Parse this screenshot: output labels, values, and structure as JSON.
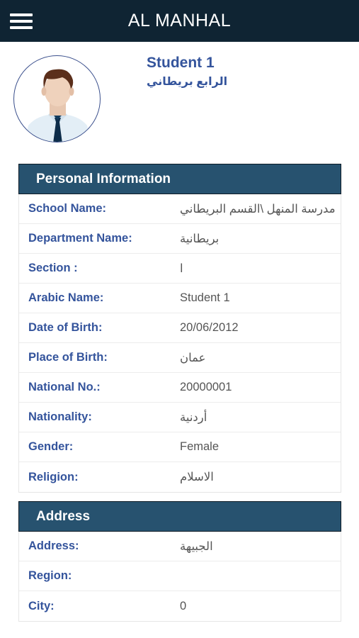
{
  "header": {
    "title": "AL MANHAL",
    "menu_icon": "hamburger-menu-icon"
  },
  "profile": {
    "name": "Student 1",
    "grade": "الرابع بريطاني",
    "avatar_icon": "student-avatar-icon"
  },
  "personal": {
    "title": "Personal Information",
    "rows": [
      {
        "label": "School Name:",
        "value": "مدرسة المنهل \\القسم البريطاني"
      },
      {
        "label": "Department Name:",
        "value": "بريطانية"
      },
      {
        "label": "Section :",
        "value": "ا"
      },
      {
        "label": "Arabic Name:",
        "value": "Student 1"
      },
      {
        "label": "Date of Birth:",
        "value": "20/06/2012"
      },
      {
        "label": "Place of Birth:",
        "value": "عمان"
      },
      {
        "label": "National No.:",
        "value": "20000001"
      },
      {
        "label": "Nationality:",
        "value": "أردنية"
      },
      {
        "label": "Gender:",
        "value": "Female"
      },
      {
        "label": "Religion:",
        "value": "الاسلام"
      }
    ]
  },
  "address": {
    "title": "Address",
    "rows": [
      {
        "label": "Address:",
        "value": "الجبيهة"
      },
      {
        "label": "Region:",
        "value": ""
      },
      {
        "label": "City:",
        "value": "0"
      }
    ]
  },
  "colors": {
    "topbar": "#0f2433",
    "section_header": "#27526f",
    "label": "#34549c",
    "value": "#555555"
  }
}
